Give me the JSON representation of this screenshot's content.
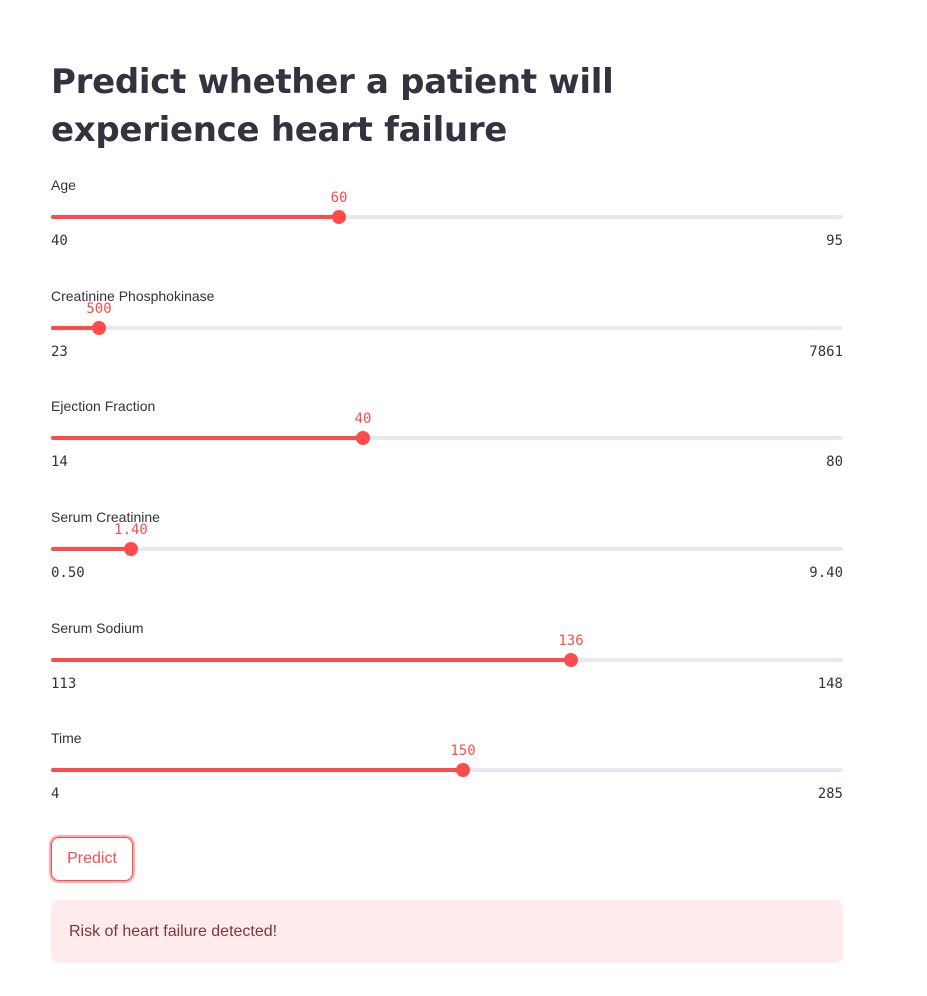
{
  "page": {
    "title": "Predict whether a patient will experience heart failure"
  },
  "sliders": [
    {
      "label": "Age",
      "value": "60",
      "min": "40",
      "max": "95",
      "fraction": 0.3636
    },
    {
      "label": "Creatinine Phosphokinase",
      "value": "500",
      "min": "23",
      "max": "7861",
      "fraction": 0.0609
    },
    {
      "label": "Ejection Fraction",
      "value": "40",
      "min": "14",
      "max": "80",
      "fraction": 0.3939
    },
    {
      "label": "Serum Creatinine",
      "value": "1.40",
      "min": "0.50",
      "max": "9.40",
      "fraction": 0.1011
    },
    {
      "label": "Serum Sodium",
      "value": "136",
      "min": "113",
      "max": "148",
      "fraction": 0.6571
    },
    {
      "label": "Time",
      "value": "150",
      "min": "4",
      "max": "285",
      "fraction": 0.5196
    }
  ],
  "predict_button": {
    "label": "Predict"
  },
  "result": {
    "message": "Risk of heart failure detected!"
  },
  "colors": {
    "accent": "#ff4b4b",
    "track": "#e6e9ef",
    "text": "#31333f",
    "alert_background": "#ffebeb",
    "alert_text": "#7d353b"
  }
}
